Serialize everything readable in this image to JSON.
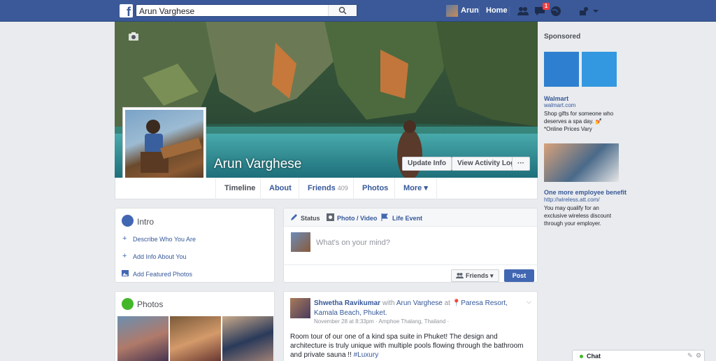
{
  "topbar": {
    "logo": "f",
    "search_value": "Arun Varghese",
    "user_name": "Arun",
    "home_label": "Home",
    "notification_count": "1"
  },
  "profile": {
    "name": "Arun Varghese",
    "update_info": "Update Info",
    "view_activity_log": "View Activity Log",
    "more_dots": "···"
  },
  "tabs": [
    {
      "label": "Timeline"
    },
    {
      "label": "About"
    },
    {
      "label": "Friends",
      "count": "409"
    },
    {
      "label": "Photos"
    },
    {
      "label": "More ▾"
    }
  ],
  "intro": {
    "title": "Intro",
    "links": [
      "Describe Who You Are",
      "Add Info About You",
      "Add Featured Photos"
    ]
  },
  "composer": {
    "tabs": [
      "Status",
      "Photo / Video",
      "Life Event"
    ],
    "placeholder": "What's on your mind?",
    "audience": "Friends",
    "post": "Post"
  },
  "photos": {
    "title": "Photos"
  },
  "post": {
    "author": "Shwetha Ravikumar",
    "with_text": "with",
    "tagged": "Arun Varghese",
    "at_text": "at",
    "place": "Paresa Resort, Kamala Beach, Phuket.",
    "meta": "November 28 at 8:33pm · Amphoe Thalang, Thailand ·",
    "body": "Room tour of our one of a kind spa suite in Phuket! The design and architecture is truly unique with multiple pools flowing through the bathroom and private sauna !!",
    "hashtag": "#Luxury"
  },
  "sponsored": {
    "label": "Sponsored",
    "ads": [
      {
        "title": "Walmart",
        "url": "walmart.com",
        "body": "Shop gifts for someone who deserves a spa day. 💅 *Online Prices Vary"
      },
      {
        "title": "One more employee benefit",
        "url": "http://wireless.att.com/",
        "body": "You may qualify for an exclusive wireless discount through your employer."
      }
    ]
  },
  "chat": {
    "label": "Chat"
  },
  "colors": {
    "brand": "#3b5998",
    "link": "#365899",
    "button": "#4267b2"
  }
}
